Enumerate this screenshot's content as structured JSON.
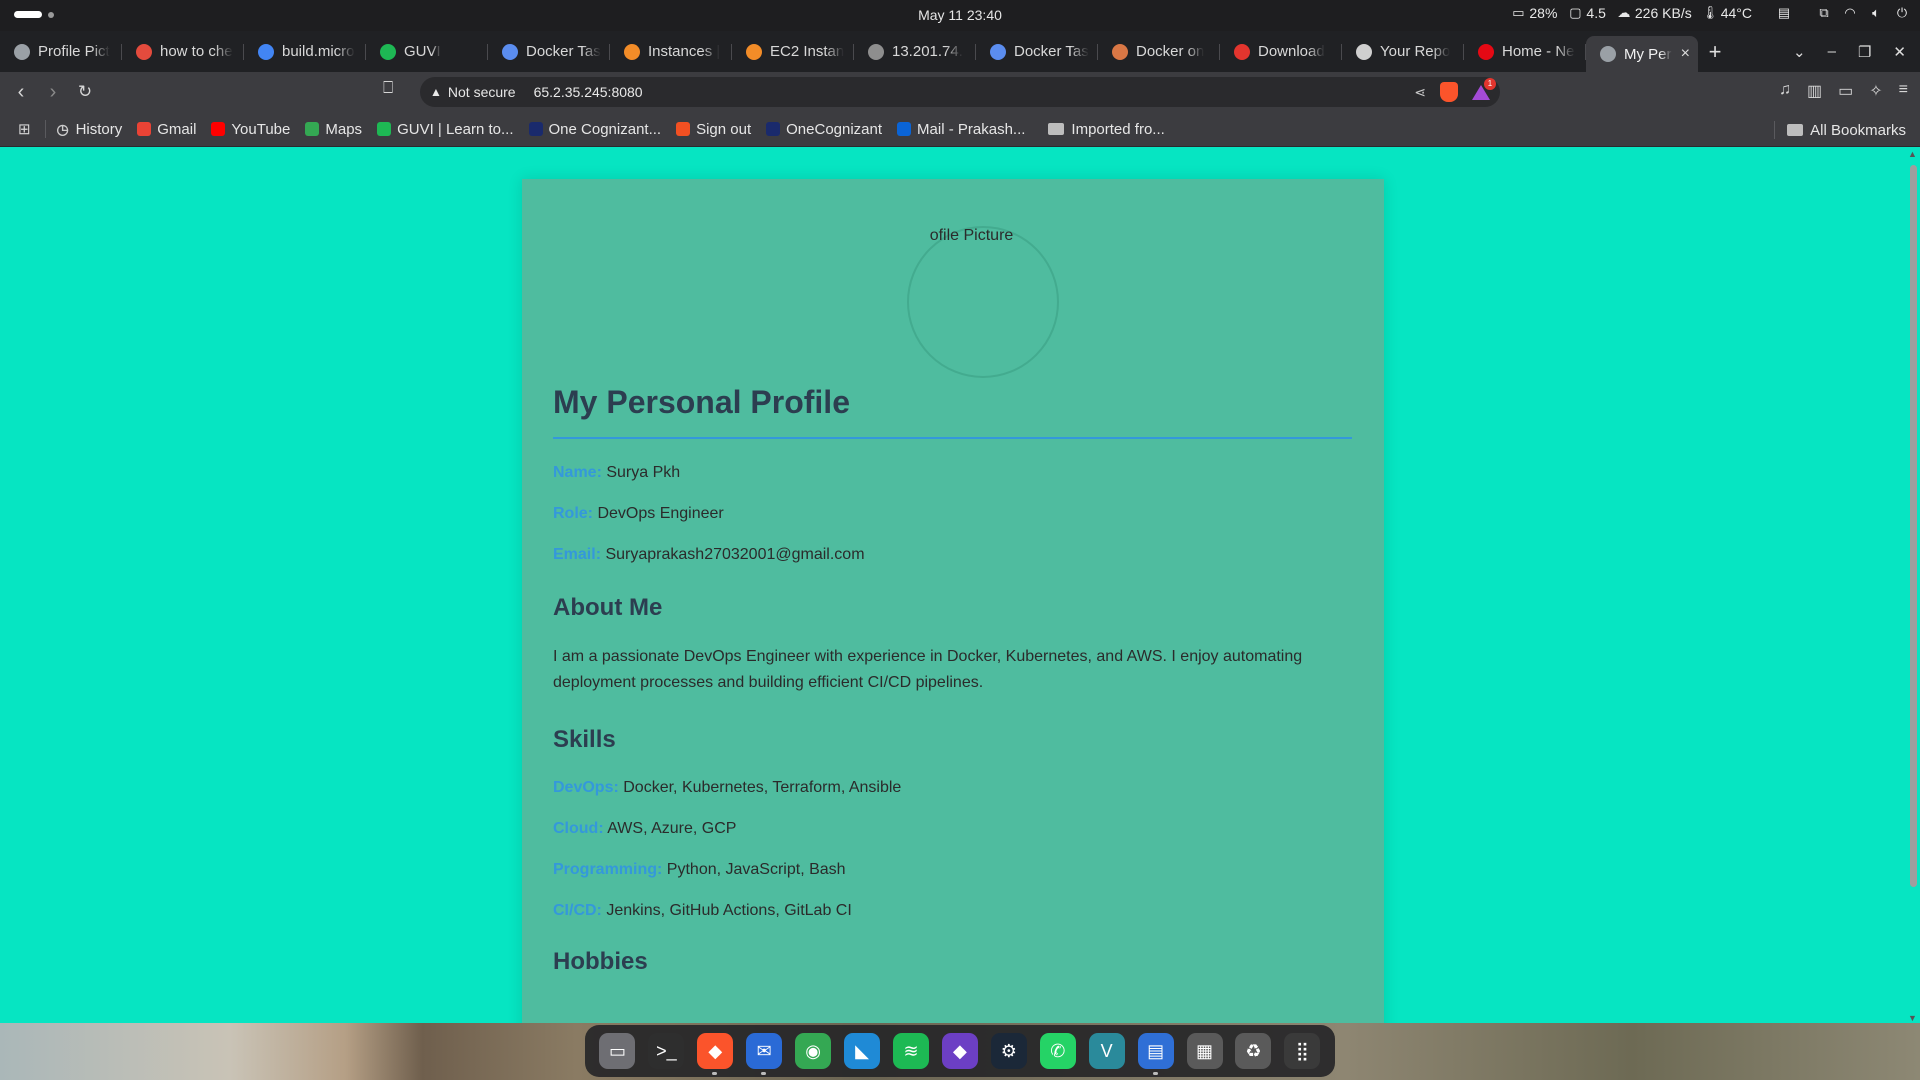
{
  "system": {
    "clock": "May 11  23:40",
    "battery": "28%",
    "load": "4.5",
    "net_speed": "226 KB/s",
    "temperature": "44°C"
  },
  "tabs": [
    {
      "title": "Profile Pict",
      "color": "#9aa0a6"
    },
    {
      "title": "how to che",
      "color": "#e34b3d"
    },
    {
      "title": "build.micro",
      "color": "#4285f4"
    },
    {
      "title": "GUVI",
      "color": "#1eb854"
    },
    {
      "title": "Docker Tas",
      "color": "#5b8def"
    },
    {
      "title": "Instances |",
      "color": "#f28c28"
    },
    {
      "title": "EC2 Instan",
      "color": "#f28c28"
    },
    {
      "title": "13.201.74.",
      "color": "#8e8e8e"
    },
    {
      "title": "Docker Tas",
      "color": "#5b8def"
    },
    {
      "title": "Docker on",
      "color": "#d97745"
    },
    {
      "title": "Download",
      "color": "#e3352e"
    },
    {
      "title": "Your Repo",
      "color": "#cfcfcf"
    },
    {
      "title": "Home - Ne",
      "color": "#e50914"
    },
    {
      "title": "My Per",
      "color": "#9aa0a6",
      "active": true
    }
  ],
  "toolbar": {
    "security_label": "Not secure",
    "url": "65.2.35.245:8080"
  },
  "bookmarks": [
    {
      "label": "History",
      "icon": "history-icon"
    },
    {
      "label": "Gmail",
      "icon": "gmail-icon",
      "color": "#ea4335"
    },
    {
      "label": "YouTube",
      "icon": "youtube-icon",
      "color": "#ff0000"
    },
    {
      "label": "Maps",
      "icon": "maps-icon",
      "color": "#34a853"
    },
    {
      "label": "GUVI | Learn to...",
      "icon": "guvi-icon",
      "color": "#1eb854"
    },
    {
      "label": "One Cognizant...",
      "icon": "cognizant-icon",
      "color": "#1a2a6c"
    },
    {
      "label": "Sign out",
      "icon": "microsoft-icon",
      "color": "#f25022"
    },
    {
      "label": "OneCognizant",
      "icon": "cognizant-icon",
      "color": "#1a2a6c"
    },
    {
      "label": "Mail - Prakash...",
      "icon": "outlook-icon",
      "color": "#0a64d6"
    },
    {
      "label": "Imported fro...",
      "icon": "folder-icon"
    }
  ],
  "all_bookmarks": "All Bookmarks",
  "profile": {
    "picture_alt": "ofile Picture",
    "title": "My Personal Profile",
    "name_label": "Name:",
    "name_value": "Surya Pkh",
    "role_label": "Role:",
    "role_value": "DevOps Engineer",
    "email_label": "Email:",
    "email_value": "Suryaprakash27032001@gmail.com",
    "about_heading": "About Me",
    "about_text": "I am a passionate DevOps Engineer with experience in Docker, Kubernetes, and AWS. I enjoy automating deployment processes and building efficient CI/CD pipelines.",
    "skills_heading": "Skills",
    "skills": [
      {
        "label": "DevOps:",
        "value": "Docker, Kubernetes, Terraform, Ansible"
      },
      {
        "label": "Cloud:",
        "value": "AWS, Azure, GCP"
      },
      {
        "label": "Programming:",
        "value": "Python, JavaScript, Bash"
      },
      {
        "label": "CI/CD:",
        "value": "Jenkins, GitHub Actions, GitLab CI"
      }
    ],
    "hobbies_heading": "Hobbies"
  },
  "colors": {
    "page_bg": "#06e5c2",
    "card_bg": "#4fbc9f",
    "accent": "#3498db",
    "heading": "#2c3e50"
  },
  "dock": [
    {
      "name": "files-app-icon",
      "color": "#6e6e73"
    },
    {
      "name": "terminal-app-icon",
      "color": "#2e2e2e"
    },
    {
      "name": "brave-app-icon",
      "color": "#fb542b"
    },
    {
      "name": "thunderbird-app-icon",
      "color": "#2a6ad6"
    },
    {
      "name": "chrome-app-icon",
      "color": "#34a853"
    },
    {
      "name": "vscode-app-icon",
      "color": "#1f8ad6"
    },
    {
      "name": "spotify-app-icon",
      "color": "#1db954"
    },
    {
      "name": "obsidian-app-icon",
      "color": "#6c3fc4"
    },
    {
      "name": "steam-app-icon",
      "color": "#1b2838"
    },
    {
      "name": "whatsapp-app-icon",
      "color": "#25d366"
    },
    {
      "name": "vim-app-icon",
      "color": "#2a8a9b"
    },
    {
      "name": "text-editor-app-icon",
      "color": "#2f6fd6"
    },
    {
      "name": "archive-app-icon",
      "color": "#5a5a5a"
    },
    {
      "name": "trash-app-icon",
      "color": "#5a5a5a"
    },
    {
      "name": "show-apps-icon",
      "color": "#3a3a3a"
    }
  ]
}
